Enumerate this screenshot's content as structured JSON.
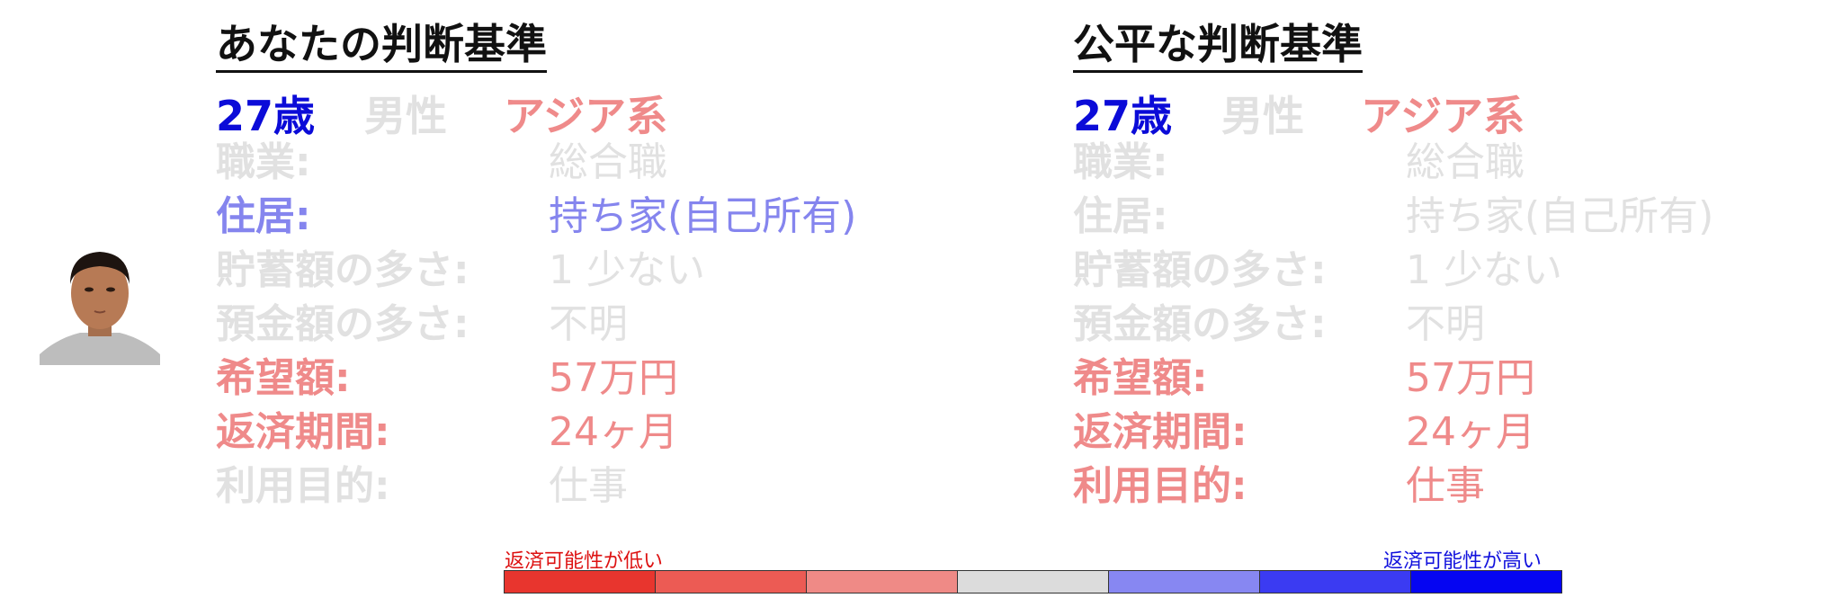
{
  "colors": {
    "grey": "#e1e1e1",
    "blue": "#0b0bd8",
    "light_blue": "#8585ee",
    "red": "#ef8a8a"
  },
  "left": {
    "title": "あなたの判断基準",
    "age": "27歳",
    "gender": "男性",
    "ethnicity": "アジア系",
    "rows": [
      {
        "label": "職業:",
        "value": "総合職"
      },
      {
        "label": "住居:",
        "value": "持ち家(自己所有)"
      },
      {
        "label": "貯蓄額の多さ:",
        "value": "1 少ない"
      },
      {
        "label": "預金額の多さ:",
        "value": "不明"
      },
      {
        "label": "希望額:",
        "value": "57万円"
      },
      {
        "label": "返済期間:",
        "value": "24ヶ月"
      },
      {
        "label": "利用目的:",
        "value": "仕事"
      }
    ]
  },
  "right": {
    "title": "公平な判断基準",
    "age": "27歳",
    "gender": "男性",
    "ethnicity": "アジア系",
    "rows": [
      {
        "label": "職業:",
        "value": "総合職"
      },
      {
        "label": "住居:",
        "value": "持ち家(自己所有)"
      },
      {
        "label": "貯蓄額の多さ:",
        "value": "1 少ない"
      },
      {
        "label": "預金額の多さ:",
        "value": "不明"
      },
      {
        "label": "希望額:",
        "value": "57万円"
      },
      {
        "label": "返済期間:",
        "value": "24ヶ月"
      },
      {
        "label": "利用目的:",
        "value": "仕事"
      }
    ]
  },
  "scale": {
    "low_label": "返済可能性が低い",
    "high_label": "返済可能性が高い",
    "segment_colors": [
      "#e8352e",
      "#ec5b54",
      "#ef8a86",
      "#dcdcdc",
      "#8787f2",
      "#3b3bf2",
      "#0505f2"
    ]
  }
}
